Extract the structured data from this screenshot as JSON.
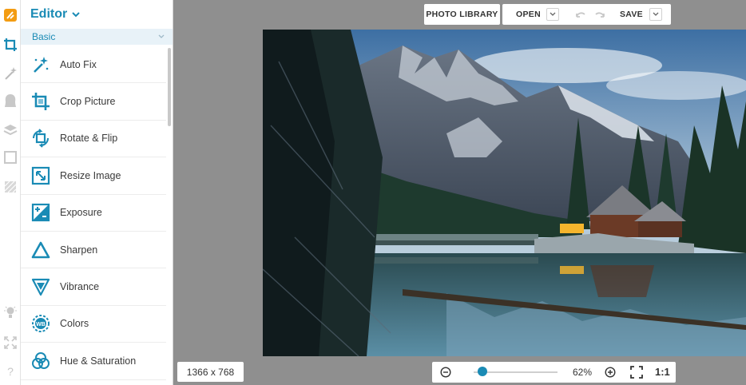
{
  "app": {
    "accent": "#1a8bb5",
    "logo_color": "#f39c12"
  },
  "panel": {
    "title": "Editor",
    "section": "Basic",
    "tools": [
      {
        "label": "Auto Fix",
        "icon": "magic-wand-icon"
      },
      {
        "label": "Crop Picture",
        "icon": "crop-icon"
      },
      {
        "label": "Rotate & Flip",
        "icon": "rotate-icon"
      },
      {
        "label": "Resize Image",
        "icon": "resize-icon"
      },
      {
        "label": "Exposure",
        "icon": "exposure-icon"
      },
      {
        "label": "Sharpen",
        "icon": "sharpen-icon"
      },
      {
        "label": "Vibrance",
        "icon": "vibrance-icon"
      },
      {
        "label": "Colors",
        "icon": "colors-icon"
      },
      {
        "label": "Hue & Saturation",
        "icon": "hue-saturation-icon"
      }
    ]
  },
  "toolbar": {
    "photo_library": "PHOTO LIBRARY",
    "open": "OPEN",
    "save": "SAVE"
  },
  "status": {
    "dimensions": "1366 x 768",
    "zoom": "62%",
    "zoom_fraction": 0.1,
    "fit": "1:1"
  }
}
